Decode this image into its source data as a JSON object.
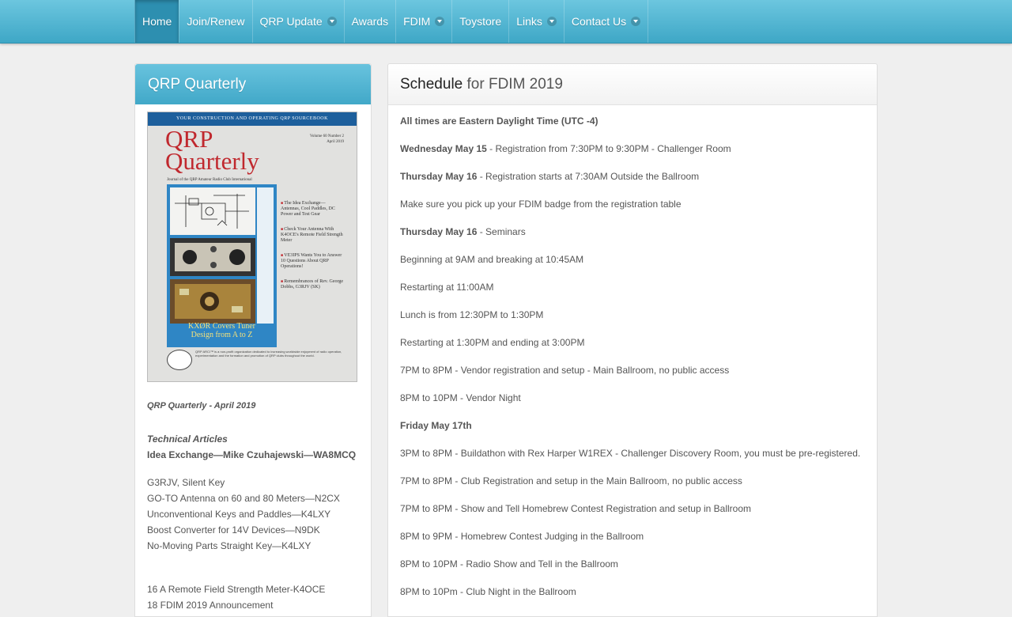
{
  "nav": {
    "items": [
      {
        "label": "Home"
      },
      {
        "label": "Join/Renew"
      },
      {
        "label": "QRP Update"
      },
      {
        "label": "Awards"
      },
      {
        "label": "FDIM"
      },
      {
        "label": "Toystore"
      },
      {
        "label": "Links"
      },
      {
        "label": "Contact Us"
      }
    ]
  },
  "sidebar": {
    "title": "QRP Quarterly",
    "cover": {
      "band": "YOUR CONSTRUCTION AND OPERATING QRP SOURCEBOOK",
      "title_line1": "QRP",
      "title_line2": "Quarterly",
      "volume": "Volume 60 Number 2",
      "date": "April 2019",
      "subtitle": "Journal of the QRP Amateur Radio Club International",
      "bullets": [
        "The Idea Exchange—Antennas, Cool Paddles, DC Power and Test Gear",
        "Check Your Antenna With K4OCE's Remote Field Strength Meter",
        "VE3IPS Wants You to Answer 10 Questions About QRP Operations!",
        "Remembrances of Rev. George Dobbs, G3RJV (SK)"
      ],
      "caption_line1": "KXØR Covers Tuner",
      "caption_line2": "Design from A to Z",
      "footer": "QRP ARCI™ is a non-profit organization dedicated to increasing worldwide enjoyment of radio operation, experimentation and the formation and promotion of QRP clubs throughout the world."
    },
    "issue_label": "QRP Quarterly - April 2019",
    "tech_heading": "Technical Articles",
    "tech_lead": "Idea Exchange—Mike Czuhajewski—WA8MCQ",
    "articles": [
      "G3RJV, Silent Key",
      "GO-TO Antenna on 60 and 80 Meters—N2CX",
      "Unconventional Keys and Paddles—K4LXY",
      "Boost Converter for 14V Devices—N9DK",
      "No-Moving Parts Straight Key—K4LXY"
    ],
    "pages": [
      "16 A Remote Field Strength Meter-K4OCE",
      "18 FDIM 2019 Announcement"
    ]
  },
  "main": {
    "title_strong": "Schedule",
    "title_light": " for FDIM 2019",
    "lines": [
      {
        "bold": "All times are Eastern Daylight Time (UTC -4)",
        "text": ""
      },
      {
        "bold": "Wednesday May 15",
        "text": " - Registration from 7:30PM to 9:30PM - Challenger Room"
      },
      {
        "bold": "Thursday May 16",
        "text": " - Registration starts at 7:30AM Outside the Ballroom"
      },
      {
        "bold": "",
        "text": "Make sure you pick up your FDIM badge from the registration table"
      },
      {
        "bold": "Thursday May 16",
        "text": " - Seminars"
      },
      {
        "bold": "",
        "text": "Beginning at 9AM and breaking at 10:45AM"
      },
      {
        "bold": "",
        "text": "Restarting at 11:00AM"
      },
      {
        "bold": "",
        "text": "Lunch is from 12:30PM to 1:30PM"
      },
      {
        "bold": "",
        "text": "Restarting at 1:30PM and ending at 3:00PM"
      },
      {
        "bold": "",
        "text": "7PM to 8PM - Vendor registration and setup - Main Ballroom, no public access"
      },
      {
        "bold": "",
        "text": "8PM to 10PM - Vendor Night"
      },
      {
        "bold": "Friday May 17th",
        "text": ""
      },
      {
        "bold": "",
        "text": "3PM to 8PM - Buildathon with Rex Harper W1REX - Challenger Discovery Room, you must be pre-registered."
      },
      {
        "bold": "",
        "text": "7PM to 8PM - Club Registration and setup in the Main Ballroom, no public access"
      },
      {
        "bold": "",
        "text": "7PM to 8PM - Show and Tell Homebrew Contest Registration and setup in Ballroom"
      },
      {
        "bold": "",
        "text": "8PM to 9PM - Homebrew Contest Judging in the Ballroom"
      },
      {
        "bold": "",
        "text": "8PM to 10PM - Radio Show and Tell in the Ballroom"
      },
      {
        "bold": "",
        "text": "8PM to 10Pm - Club Night in the Ballroom"
      }
    ]
  }
}
